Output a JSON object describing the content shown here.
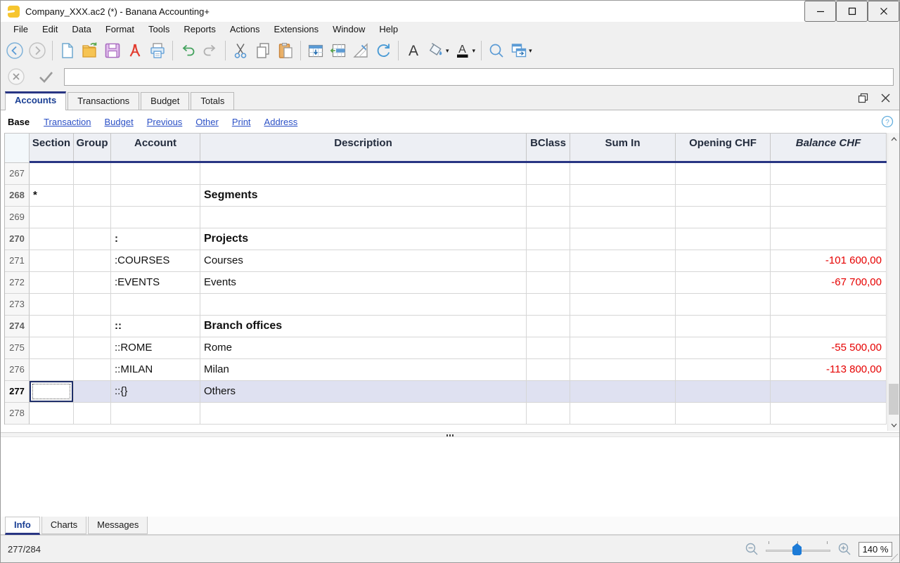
{
  "window": {
    "title": "Company_XXX.ac2 (*) - Banana Accounting+",
    "controls": [
      "minimize",
      "maximize",
      "close"
    ]
  },
  "menu": {
    "items": [
      "File",
      "Edit",
      "Data",
      "Format",
      "Tools",
      "Reports",
      "Actions",
      "Extensions",
      "Window",
      "Help"
    ]
  },
  "toolbar": {
    "groups": [
      [
        "back",
        "forward"
      ],
      [
        "new-file",
        "open-file",
        "save-file",
        "pdf-export",
        "print"
      ],
      [
        "undo",
        "redo"
      ],
      [
        "cut",
        "copy",
        "paste"
      ],
      [
        "insert-rows",
        "extract-rows",
        "table-design",
        "recalculate"
      ],
      [
        "font",
        "fill-color",
        "font-color"
      ],
      [
        "search",
        "show-windows"
      ]
    ],
    "dropdowns": [
      "fill-color",
      "font-color",
      "show-windows"
    ]
  },
  "edit_bar": {
    "value": "",
    "cancel_icon": "cancel-x-icon",
    "confirm_icon": "checkmark-icon"
  },
  "tabs": {
    "items": [
      {
        "label": "Accounts",
        "active": true
      },
      {
        "label": "Transactions",
        "active": false
      },
      {
        "label": "Budget",
        "active": false
      },
      {
        "label": "Totals",
        "active": false
      }
    ]
  },
  "views": {
    "base": "Base",
    "links": [
      "Transaction",
      "Budget",
      "Previous",
      "Other",
      "Print",
      "Address"
    ]
  },
  "table": {
    "columns": [
      "Section",
      "Group",
      "Account",
      "Description",
      "BClass",
      "Sum In",
      "Opening CHF",
      "Balance CHF"
    ],
    "rows": [
      {
        "num": "267",
        "section": "",
        "group": "",
        "account": "",
        "description": "",
        "bclass": "",
        "sum_in": "",
        "opening": "",
        "balance": ""
      },
      {
        "num": "268",
        "section": "*",
        "group": "",
        "account": "",
        "description": "Segments",
        "bclass": "",
        "sum_in": "",
        "opening": "",
        "balance": "",
        "heading": true
      },
      {
        "num": "269",
        "section": "",
        "group": "",
        "account": "",
        "description": "",
        "bclass": "",
        "sum_in": "",
        "opening": "",
        "balance": ""
      },
      {
        "num": "270",
        "section": "",
        "group": "",
        "account": ":",
        "description": "Projects",
        "bclass": "",
        "sum_in": "",
        "opening": "",
        "balance": "",
        "heading": true
      },
      {
        "num": "271",
        "section": "",
        "group": "",
        "account": ":COURSES",
        "description": "Courses",
        "bclass": "",
        "sum_in": "",
        "opening": "",
        "balance": "-101 600,00"
      },
      {
        "num": "272",
        "section": "",
        "group": "",
        "account": ":EVENTS",
        "description": "Events",
        "bclass": "",
        "sum_in": "",
        "opening": "",
        "balance": "-67 700,00"
      },
      {
        "num": "273",
        "section": "",
        "group": "",
        "account": "",
        "description": "",
        "bclass": "",
        "sum_in": "",
        "opening": "",
        "balance": ""
      },
      {
        "num": "274",
        "section": "",
        "group": "",
        "account": "::",
        "description": "Branch offices",
        "bclass": "",
        "sum_in": "",
        "opening": "",
        "balance": "",
        "heading": true
      },
      {
        "num": "275",
        "section": "",
        "group": "",
        "account": "::ROME",
        "description": "Rome",
        "bclass": "",
        "sum_in": "",
        "opening": "",
        "balance": "-55 500,00"
      },
      {
        "num": "276",
        "section": "",
        "group": "",
        "account": "::MILAN",
        "description": "Milan",
        "bclass": "",
        "sum_in": "",
        "opening": "",
        "balance": "-113 800,00"
      },
      {
        "num": "277",
        "section": "",
        "group": "",
        "account": "::{}",
        "description": "Others",
        "bclass": "",
        "sum_in": "",
        "opening": "",
        "balance": "",
        "selected": true
      },
      {
        "num": "278",
        "section": "",
        "group": "",
        "account": "",
        "description": "",
        "bclass": "",
        "sum_in": "",
        "opening": "",
        "balance": ""
      }
    ]
  },
  "bottom_tabs": {
    "items": [
      {
        "label": "Info",
        "active": true
      },
      {
        "label": "Charts",
        "active": false
      },
      {
        "label": "Messages",
        "active": false
      }
    ]
  },
  "status": {
    "record_position": "277/284",
    "zoom_level": "140 %"
  },
  "colors": {
    "accent_navy": "#283583",
    "link_blue": "#2b50c6",
    "active_tab_text": "#1a3f94",
    "negative_red": "#e60000",
    "selection_row": "#dfe1f1",
    "slider_handle_blue": "#1d7bd7",
    "app_icon_yellow": "#f6c52e"
  }
}
